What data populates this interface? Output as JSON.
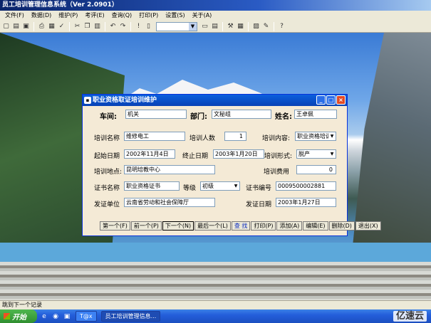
{
  "app": {
    "title": "员工培训管理信息系统（Ver 2.0901）"
  },
  "menu": [
    {
      "label": "文件(F)"
    },
    {
      "label": "数据(D)"
    },
    {
      "label": "维护(P)"
    },
    {
      "label": "考评(E)"
    },
    {
      "label": "查询(Q)"
    },
    {
      "label": "打印(P)"
    },
    {
      "label": "设置(S)"
    },
    {
      "label": "关于(A)"
    }
  ],
  "toolbar": {
    "combo_value": ""
  },
  "dialog": {
    "title": "职业资格取证培训维护",
    "header": {
      "org_label": "车间:",
      "org_value": "机关",
      "dept_label": "部门:",
      "dept_value": "文秘组",
      "name_label": "姓名:",
      "name_value": "王卓佩"
    },
    "fields": {
      "training_name_label": "培训名称",
      "training_name_value": "维修电工",
      "trainee_count_label": "培训人数",
      "trainee_count_value": "1",
      "content_label": "培训内容:",
      "content_value": "职业资格培训",
      "start_date_label": "起始日期",
      "start_date_value": "2002年11月4日",
      "end_date_label": "终止日期",
      "end_date_value": "2003年1月20日",
      "form_label": "培训形式:",
      "form_value": "脱产",
      "location_label": "培训地点:",
      "location_value": "昆明培教中心",
      "fee_label": "培训费用",
      "fee_value": "0",
      "cert_name_label": "证书名称",
      "cert_name_value": "职业资格证书",
      "level_label": "等级",
      "level_value": "初级",
      "cert_no_label": "证书编号",
      "cert_no_value": "0009500002881",
      "issuer_label": "发证单位",
      "issuer_value": "云南省劳动和社会保障厅",
      "issue_date_label": "发证日期",
      "issue_date_value": "2003年1月27日"
    },
    "buttons": [
      {
        "label": "第一个(F)"
      },
      {
        "label": "前一个(P)"
      },
      {
        "label": "下一个(N)"
      },
      {
        "label": "最后一个(L)"
      },
      {
        "label": "查 找"
      },
      {
        "label": "打印(P)"
      },
      {
        "label": "添加(A)"
      },
      {
        "label": "编辑(E)"
      },
      {
        "label": "删除(D)"
      },
      {
        "label": "退出(X)"
      }
    ]
  },
  "status": {
    "text": "跳到下一个记录"
  },
  "taskbar": {
    "start_label": "开始",
    "tasks": [
      {
        "label": "T@x"
      },
      {
        "label": "员工培训管理信息..."
      }
    ],
    "tray_logo": "亿速云"
  }
}
